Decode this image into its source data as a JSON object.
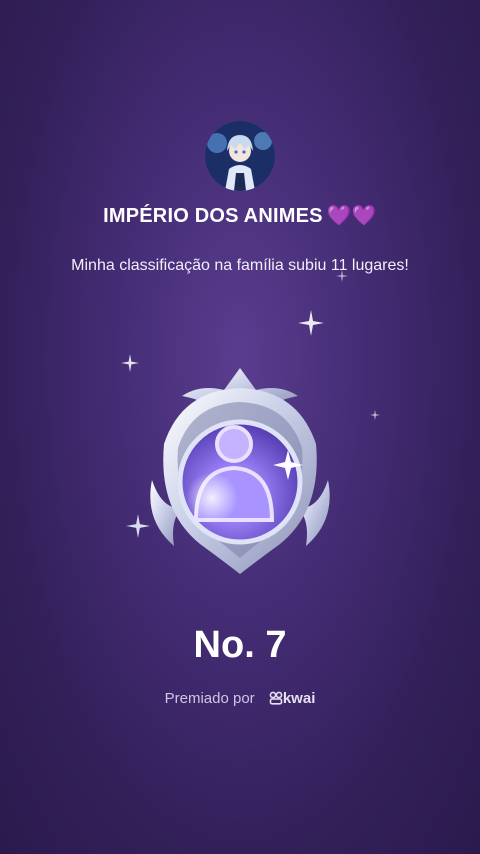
{
  "family": {
    "name": "IMPÉRIO DOS ANIMES",
    "hearts": "💜💜"
  },
  "rank": {
    "message": "Minha classificação na família subiu 11 lugares!",
    "number": "No. 7"
  },
  "awarded": {
    "label": "Premiado por",
    "brand": "kwai"
  },
  "colors": {
    "background": "#442c74",
    "heart": "#c15cf2",
    "badge_core": "#8a6cf0"
  },
  "icons": {
    "avatar": "avatar-image",
    "badge": "rank-badge-icon",
    "brand": "kwai-logo-icon"
  }
}
